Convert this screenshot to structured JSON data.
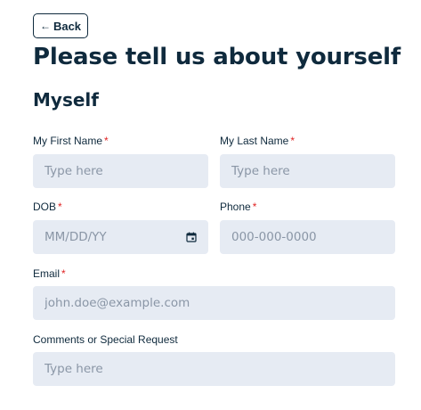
{
  "back": {
    "arrow": "←",
    "label": "Back"
  },
  "page_title": "Please tell us about yourself",
  "section_title": "Myself",
  "fields": {
    "first_name": {
      "label": "My First Name",
      "required": "*",
      "placeholder": "Type here",
      "value": ""
    },
    "last_name": {
      "label": "My Last Name",
      "required": "*",
      "placeholder": "Type here",
      "value": ""
    },
    "dob": {
      "label": "DOB",
      "required": "*",
      "placeholder": "MM/DD/YY",
      "icon": "calendar-icon"
    },
    "phone": {
      "label": "Phone",
      "required": "*",
      "placeholder": "000-000-0000",
      "value": ""
    },
    "email": {
      "label": "Email",
      "required": "*",
      "placeholder": "john.doe@example.com",
      "value": ""
    },
    "comments": {
      "label": "Comments or Special Request",
      "placeholder": "Type here",
      "value": ""
    }
  },
  "colors": {
    "text": "#0f2a3d",
    "required": "#e02424",
    "field_bg": "#e6ebf3",
    "placeholder": "#8a96a6"
  }
}
